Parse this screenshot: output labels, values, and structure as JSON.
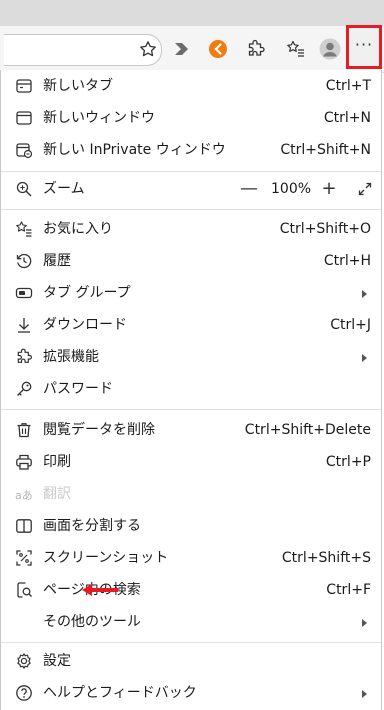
{
  "menu": {
    "new_tab": {
      "label": "新しいタブ",
      "shortcut": "Ctrl+T"
    },
    "new_window": {
      "label": "新しいウィンドウ",
      "shortcut": "Ctrl+N"
    },
    "new_inprivate": {
      "label": "新しい InPrivate ウィンドウ",
      "shortcut": "Ctrl+Shift+N"
    },
    "zoom": {
      "label": "ズーム",
      "minus": "—",
      "value": "100%",
      "plus": "+"
    },
    "favorites": {
      "label": "お気に入り",
      "shortcut": "Ctrl+Shift+O"
    },
    "history": {
      "label": "履歴",
      "shortcut": "Ctrl+H"
    },
    "tab_groups": {
      "label": "タブ グループ"
    },
    "downloads": {
      "label": "ダウンロード",
      "shortcut": "Ctrl+J"
    },
    "extensions": {
      "label": "拡張機能"
    },
    "passwords": {
      "label": "パスワード"
    },
    "clear_data": {
      "label": "閲覧データを削除",
      "shortcut": "Ctrl+Shift+Delete"
    },
    "print": {
      "label": "印刷",
      "shortcut": "Ctrl+P"
    },
    "translate": {
      "label": "翻訳"
    },
    "split_screen": {
      "label": "画面を分割する"
    },
    "screenshot": {
      "label": "スクリーンショット",
      "shortcut": "Ctrl+Shift+S"
    },
    "find": {
      "label": "ページ内の検索",
      "shortcut": "Ctrl+F"
    },
    "more_tools": {
      "label": "その他のツール"
    },
    "settings": {
      "label": "設定"
    },
    "help": {
      "label": "ヘルプとフィードバック"
    }
  },
  "toolbar": {
    "more_button_glyph": "···",
    "accent_highlight": "#e51c23"
  },
  "icons": {
    "favorite": "star-outline-icon",
    "copilot": "chevron-play-icon",
    "extension_orange": "orange-extension-icon",
    "extensions": "puzzle-icon",
    "collections": "star-list-icon",
    "profile": "profile-avatar-icon",
    "more": "ellipsis-icon"
  },
  "annotation": {
    "arrow_color": "#e51c23"
  }
}
